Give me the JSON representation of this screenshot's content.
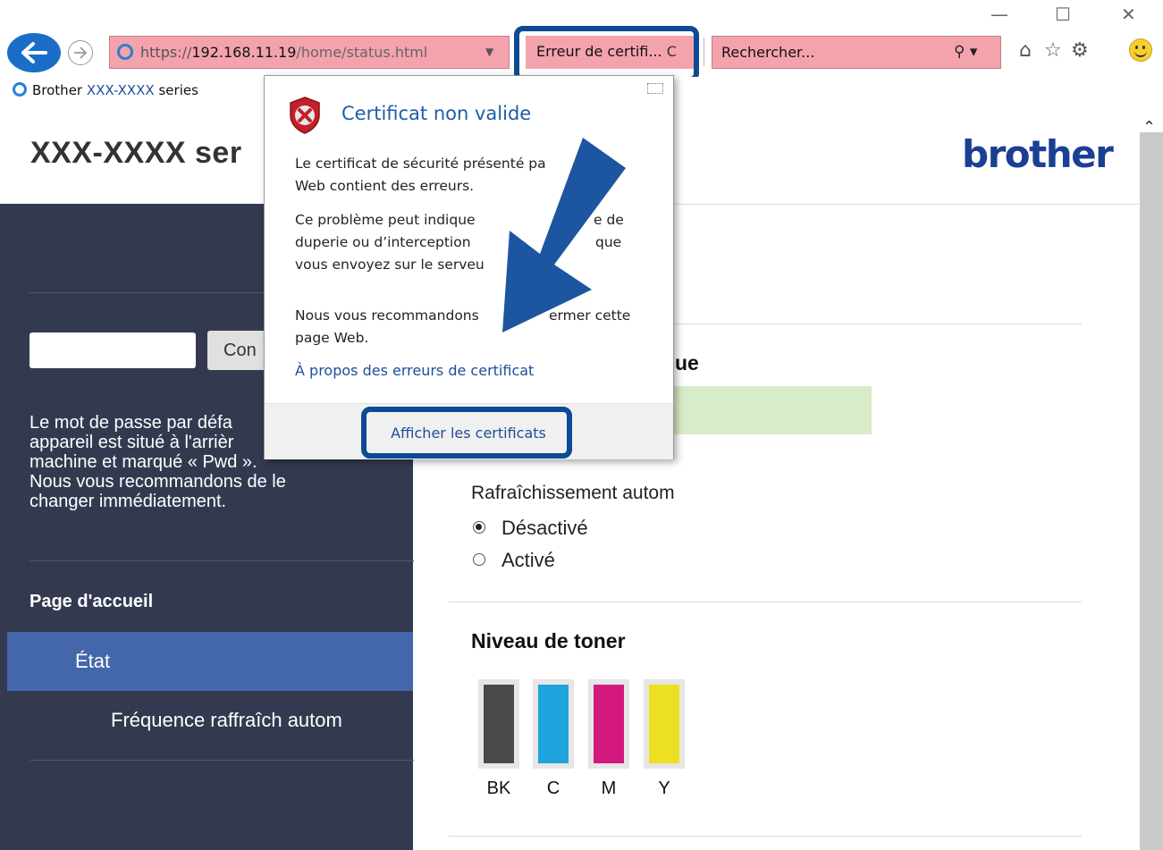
{
  "browser": {
    "url_scheme": "https://",
    "url_host": "192.168.11.19",
    "url_path": "/home/status.html",
    "cert_error_label": "Erreur de certifi...",
    "search_placeholder": "Rechercher...",
    "tab_title_prefix": "Brother ",
    "tab_title_model": "XXX-XXXX",
    "tab_title_suffix": " series"
  },
  "page": {
    "header_title": "XXX-XXXX ser",
    "brand": "brother",
    "login_button": "Con",
    "password_note": [
      "Le mot de passe par défa",
      "appareil est situé à l'arrièr",
      "machine et marqué « Pwd ».",
      "Nous vous recommandons de le",
      "changer immédiatement."
    ],
    "nav_home": "Page d'accueil",
    "nav_active": "État",
    "nav_sub": "Fréquence raffraîch autom",
    "section_partial": "ue",
    "refresh_label": "Rafraîchissement autom",
    "refresh_options": [
      "Désactivé",
      "Activé"
    ],
    "refresh_selected": 0,
    "toner_heading": "Niveau de toner",
    "toner": [
      {
        "label": "BK",
        "color": "#4a4a4a",
        "level": 1.0
      },
      {
        "label": "C",
        "color": "#1ea3dc",
        "level": 1.0
      },
      {
        "label": "M",
        "color": "#d4197e",
        "level": 1.0
      },
      {
        "label": "Y",
        "color": "#ece021",
        "level": 1.0
      }
    ]
  },
  "popup": {
    "title": "Certificat non valide",
    "para1": [
      "Le certificat de sécurité présenté pa",
      "Web contient des erreurs."
    ],
    "para2": [
      "Ce problème peut indique",
      "e de",
      "duperie ou d’interception",
      "que",
      "vous envoyez sur le serveu"
    ],
    "para3": [
      "Nous vous recommandons",
      "ermer cette",
      "page Web."
    ],
    "link": "À propos des erreurs de certificat",
    "button": "Afficher les certificats"
  },
  "colors": {
    "highlight": "#0d4a94",
    "sidebar": "#333a50",
    "active_nav": "#4466aa",
    "brand": "#1c3f94",
    "error_bar": "#f4a3ad"
  }
}
